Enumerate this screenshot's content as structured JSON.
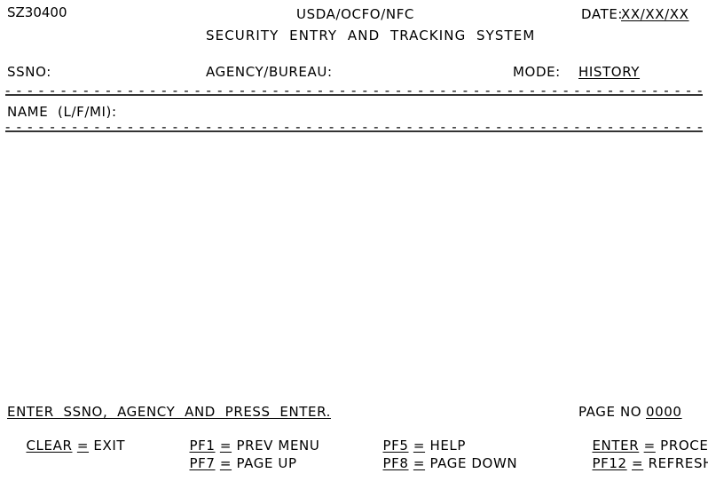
{
  "screen": {
    "program_id": "SZ30400",
    "agency_line": "USDA/OCFO/NFC",
    "title_line": "SECURITY  ENTRY  AND  TRACKING  SYSTEM",
    "date_label": "DATE:",
    "date_value": "XX/XX/XX"
  },
  "fields": {
    "ssno_label": "SSNO:",
    "ssno_value": "",
    "agency_label": "AGENCY/BUREAU:",
    "agency_value": "",
    "mode_label": "MODE:",
    "mode_value": "HISTORY",
    "name_label": "NAME  (L/F/MI):",
    "name_value": ""
  },
  "separators": {
    "dash_run": "- - - - - - - - - - - - - - - - - - - - - - - - - - - - - - - - - - - - - - - - - - - - - - - - - - - - - - - - - - - - - - - - - - - - - - - - - - - - - - - - - - - - - -"
  },
  "commands": {
    "instruction": "ENTER  SSNO,  AGENCY  AND  PRESS  ENTER.",
    "col1": [
      {
        "key": "CLEAR",
        "eq": "=",
        "action": "EXIT"
      }
    ],
    "col2": [
      {
        "key": "PF1",
        "eq": "=",
        "action": "PREV MENU"
      },
      {
        "key": "PF7",
        "eq": "=",
        "action": "PAGE UP"
      }
    ],
    "col3": [
      {
        "key": "PF5",
        "eq": "=",
        "action": "HELP"
      },
      {
        "key": "PF8",
        "eq": "=",
        "action": "PAGE DOWN"
      }
    ],
    "col4": [
      {
        "key": "ENTER",
        "eq": "=",
        "action": "PROCESS"
      },
      {
        "key": "PF12",
        "eq": "=",
        "action": "REFRESH"
      }
    ],
    "page_no_label": "PAGE NO",
    "page_no_value": "0000"
  },
  "colors": {
    "text": "#000000",
    "rule": "#333333",
    "background": "#ffffff"
  }
}
